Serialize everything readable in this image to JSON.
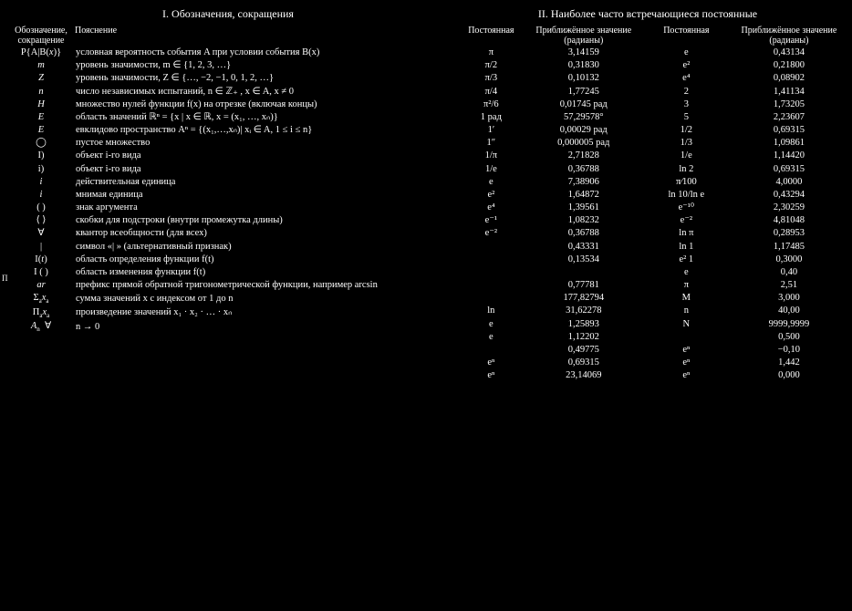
{
  "page_tag": "П",
  "sec1": {
    "title": "I. Обозначения, сокращения",
    "headers": [
      "Обозначение,\nсокращение",
      "Пояснение"
    ],
    "rows": [
      {
        "sym": "P{A|B(x)}",
        "sym_html": "P{A|B(<span class='it'>x</span>)}",
        "txt": "условная вероятность события A при условии события B(x)"
      },
      {
        "sym": "m",
        "sym_html": "<span class='it'>m</span>",
        "txt": "уровень значимости, m ∈ {1, 2, 3, …}"
      },
      {
        "sym": "Z",
        "sym_html": "<span class='it'>Z</span>",
        "txt": "уровень значимости, Z ∈ {…, −2, −1, 0, 1, 2, …}"
      },
      {
        "sym": "n",
        "sym_html": "<span class='it'>n</span>",
        "txt": "число независимых испытаний, n ∈ ℤ₊ , x ∈ A, x ≠ 0"
      },
      {
        "sym": "H",
        "sym_html": "<span class='it'>H</span>",
        "txt": "множество нулей функции f(x) на отрезке (включая концы)"
      },
      {
        "sym": "E",
        "sym_html": "<span class='it'>E</span>",
        "txt": "область значений ℝⁿ = {x | x ∈ ℝ, x = (x₁, …, xₙ)}"
      },
      {
        "sym": "E",
        "sym_html": "<span class='it'>E</span>",
        "txt": "евклидово пространство Aⁿ = {(x₁,…,xₙ)| xᵢ ∈ A, 1 ≤ i ≤ n}"
      },
      {
        "sym": "◯",
        "sym_html": "◯",
        "txt": "пустое множество"
      },
      {
        "sym": "I)",
        "sym_html": "I)",
        "txt": "объект i-го вида"
      },
      {
        "sym": "i)",
        "sym_html": "i)",
        "txt": "объект i-го вида"
      },
      {
        "sym": "i",
        "sym_html": "<span class='it'>i</span>",
        "txt": "действительная единица"
      },
      {
        "sym": "i",
        "sym_html": "<span class='it'>i</span>",
        "txt": "мнимая единица"
      },
      {
        "sym": "( )",
        "sym_html": "( )",
        "txt": "знак аргумента"
      },
      {
        "sym": "⟨ ⟩",
        "sym_html": "⟨ ⟩",
        "txt": "скобки для подстроки (внутри промежутка длины)"
      },
      {
        "sym": "∀",
        "sym_html": "∀",
        "txt": "квантор всеобщности (для всех)"
      },
      {
        "sym": "|",
        "sym_html": "|",
        "txt": "символ «| » (альтернативный признак)"
      },
      {
        "sym": "I(t)",
        "sym_html": "I(<span class='it'>t</span>)",
        "txt": "область определения функции f(t)"
      },
      {
        "sym": "I ( )",
        "sym_html": "I ( )",
        "txt": "область изменения функции f(t)"
      },
      {
        "sym": "ar",
        "sym_html": "<span class='it'>ar</span>",
        "txt": "префикс прямой обратной тригонометрической функции, например arcsin"
      },
      {
        "sym": "Σxₐ",
        "sym_html": "Σ<span class='sub'>a</span><span class='it'>x</span><span class='sub'>a</span>",
        "txt": "сумма значений x с индексом от 1 до n"
      },
      {
        "sym": "Πxₐ",
        "sym_html": "Π<span class='sub'>a</span><span class='it'>x</span><span class='sub'>a</span>",
        "txt": "произведение значений x₁ · x₂ · … · xₙ"
      },
      {
        "sym": "Aₙ  ∀",
        "sym_html": "<span class='it'>A</span><span class='sub'>n</span>&nbsp;&nbsp;∀",
        "txt": "n → 0"
      }
    ]
  },
  "sec2": {
    "title": "II. Наиболее часто встречающиеся постоянные",
    "headers": [
      "Постоянная",
      "Приближённое\nзначение\n(радианы)",
      "Постоянная",
      "Приближённое\nзначение\n(радианы)"
    ],
    "rows": [
      {
        "a": "π",
        "av": "3,14159",
        "b": "e",
        "bv": "0,43134"
      },
      {
        "a": "π/2",
        "av": "0,31830",
        "b": "e²",
        "bv": "0,21800"
      },
      {
        "a": "π/3",
        "av": "0,10132",
        "b": "e⁴",
        "bv": "0,08902"
      },
      {
        "a": "π/4",
        "av": "1,77245",
        "b": "2",
        "bv": "1,41134"
      },
      {
        "a": "π²/6",
        "av": "0,01745 рад",
        "b": "3",
        "bv": "1,73205"
      },
      {
        "a": "1 рад",
        "av": "57,29578°",
        "b": "5",
        "bv": "2,23607"
      },
      {
        "a": "1′",
        "av": "0,00029 рад",
        "b": "1/2",
        "bv": "0,69315"
      },
      {
        "a": "1″",
        "av": "0,000005 рад",
        "b": "1/3",
        "bv": "1,09861"
      },
      {
        "a": "1/π",
        "av": "2,71828",
        "b": "1/e",
        "bv": "1,14420"
      },
      {
        "a": "1/e",
        "av": "0,36788",
        "b": "ln 2",
        "bv": "0,69315"
      },
      {
        "a": "e",
        "av": "7,38906",
        "b": "π⁄100",
        "bv": "4,0000"
      },
      {
        "a": "e²",
        "av": "1,64872",
        "b": "ln 10/ln e",
        "bv": "0,43294"
      },
      {
        "a": "e⁴",
        "av": "1,39561",
        "b": "e⁻¹⁰",
        "bv": "2,30259"
      },
      {
        "a": "e⁻¹",
        "av": "1,08232",
        "b": "e⁻²",
        "bv": "4,81048"
      },
      {
        "a": "e⁻²",
        "av": "0,36788",
        "b": "ln π",
        "bv": "0,28953"
      },
      {
        "a": "",
        "av": "0,43331",
        "b": "ln 1",
        "bv": "1,17485"
      },
      {
        "a": "",
        "av": "0,13534",
        "b": "e² 1",
        "bv": "0,3000"
      },
      {
        "a": "",
        "av": "",
        "b": "e",
        "bv": "0,40"
      },
      {
        "a": "",
        "av": "0,77781",
        "b": "π",
        "bv": "2,51"
      },
      {
        "a": "",
        "av": "177,82794",
        "b": "M",
        "bv": "3,000"
      },
      {
        "a": "ln",
        "av": "31,62278",
        "b": "n",
        "bv": "40,00"
      },
      {
        "a": "e",
        "av": "1,25893",
        "b": "N",
        "bv": "9999,9999"
      },
      {
        "a": "e",
        "av": "1,12202",
        "b": "",
        "bv": "0,500"
      },
      {
        "a": "",
        "av": "0,49775",
        "b": "eⁿ",
        "bv": "−0,10"
      },
      {
        "a": "eⁿ",
        "av": "0,69315",
        "b": "eⁿ",
        "bv": "1,442"
      },
      {
        "a": "eⁿ",
        "av": "23,14069",
        "b": "eⁿ",
        "bv": "0,000"
      }
    ]
  }
}
